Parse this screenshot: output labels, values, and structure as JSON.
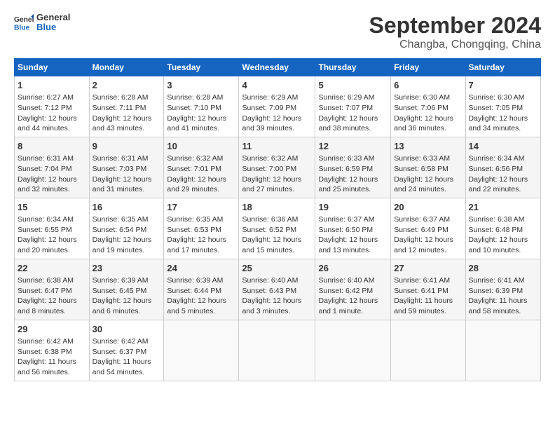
{
  "header": {
    "logo_general": "General",
    "logo_blue": "Blue",
    "month_title": "September 2024",
    "location": "Changba, Chongqing, China"
  },
  "days_of_week": [
    "Sunday",
    "Monday",
    "Tuesday",
    "Wednesday",
    "Thursday",
    "Friday",
    "Saturday"
  ],
  "weeks": [
    [
      {
        "day": "1",
        "lines": [
          "Sunrise: 6:27 AM",
          "Sunset: 7:12 PM",
          "Daylight: 12 hours",
          "and 44 minutes."
        ]
      },
      {
        "day": "2",
        "lines": [
          "Sunrise: 6:28 AM",
          "Sunset: 7:11 PM",
          "Daylight: 12 hours",
          "and 43 minutes."
        ]
      },
      {
        "day": "3",
        "lines": [
          "Sunrise: 6:28 AM",
          "Sunset: 7:10 PM",
          "Daylight: 12 hours",
          "and 41 minutes."
        ]
      },
      {
        "day": "4",
        "lines": [
          "Sunrise: 6:29 AM",
          "Sunset: 7:09 PM",
          "Daylight: 12 hours",
          "and 39 minutes."
        ]
      },
      {
        "day": "5",
        "lines": [
          "Sunrise: 6:29 AM",
          "Sunset: 7:07 PM",
          "Daylight: 12 hours",
          "and 38 minutes."
        ]
      },
      {
        "day": "6",
        "lines": [
          "Sunrise: 6:30 AM",
          "Sunset: 7:06 PM",
          "Daylight: 12 hours",
          "and 36 minutes."
        ]
      },
      {
        "day": "7",
        "lines": [
          "Sunrise: 6:30 AM",
          "Sunset: 7:05 PM",
          "Daylight: 12 hours",
          "and 34 minutes."
        ]
      }
    ],
    [
      {
        "day": "8",
        "lines": [
          "Sunrise: 6:31 AM",
          "Sunset: 7:04 PM",
          "Daylight: 12 hours",
          "and 32 minutes."
        ]
      },
      {
        "day": "9",
        "lines": [
          "Sunrise: 6:31 AM",
          "Sunset: 7:03 PM",
          "Daylight: 12 hours",
          "and 31 minutes."
        ]
      },
      {
        "day": "10",
        "lines": [
          "Sunrise: 6:32 AM",
          "Sunset: 7:01 PM",
          "Daylight: 12 hours",
          "and 29 minutes."
        ]
      },
      {
        "day": "11",
        "lines": [
          "Sunrise: 6:32 AM",
          "Sunset: 7:00 PM",
          "Daylight: 12 hours",
          "and 27 minutes."
        ]
      },
      {
        "day": "12",
        "lines": [
          "Sunrise: 6:33 AM",
          "Sunset: 6:59 PM",
          "Daylight: 12 hours",
          "and 25 minutes."
        ]
      },
      {
        "day": "13",
        "lines": [
          "Sunrise: 6:33 AM",
          "Sunset: 6:58 PM",
          "Daylight: 12 hours",
          "and 24 minutes."
        ]
      },
      {
        "day": "14",
        "lines": [
          "Sunrise: 6:34 AM",
          "Sunset: 6:56 PM",
          "Daylight: 12 hours",
          "and 22 minutes."
        ]
      }
    ],
    [
      {
        "day": "15",
        "lines": [
          "Sunrise: 6:34 AM",
          "Sunset: 6:55 PM",
          "Daylight: 12 hours",
          "and 20 minutes."
        ]
      },
      {
        "day": "16",
        "lines": [
          "Sunrise: 6:35 AM",
          "Sunset: 6:54 PM",
          "Daylight: 12 hours",
          "and 19 minutes."
        ]
      },
      {
        "day": "17",
        "lines": [
          "Sunrise: 6:35 AM",
          "Sunset: 6:53 PM",
          "Daylight: 12 hours",
          "and 17 minutes."
        ]
      },
      {
        "day": "18",
        "lines": [
          "Sunrise: 6:36 AM",
          "Sunset: 6:52 PM",
          "Daylight: 12 hours",
          "and 15 minutes."
        ]
      },
      {
        "day": "19",
        "lines": [
          "Sunrise: 6:37 AM",
          "Sunset: 6:50 PM",
          "Daylight: 12 hours",
          "and 13 minutes."
        ]
      },
      {
        "day": "20",
        "lines": [
          "Sunrise: 6:37 AM",
          "Sunset: 6:49 PM",
          "Daylight: 12 hours",
          "and 12 minutes."
        ]
      },
      {
        "day": "21",
        "lines": [
          "Sunrise: 6:38 AM",
          "Sunset: 6:48 PM",
          "Daylight: 12 hours",
          "and 10 minutes."
        ]
      }
    ],
    [
      {
        "day": "22",
        "lines": [
          "Sunrise: 6:38 AM",
          "Sunset: 6:47 PM",
          "Daylight: 12 hours",
          "and 8 minutes."
        ]
      },
      {
        "day": "23",
        "lines": [
          "Sunrise: 6:39 AM",
          "Sunset: 6:45 PM",
          "Daylight: 12 hours",
          "and 6 minutes."
        ]
      },
      {
        "day": "24",
        "lines": [
          "Sunrise: 6:39 AM",
          "Sunset: 6:44 PM",
          "Daylight: 12 hours",
          "and 5 minutes."
        ]
      },
      {
        "day": "25",
        "lines": [
          "Sunrise: 6:40 AM",
          "Sunset: 6:43 PM",
          "Daylight: 12 hours",
          "and 3 minutes."
        ]
      },
      {
        "day": "26",
        "lines": [
          "Sunrise: 6:40 AM",
          "Sunset: 6:42 PM",
          "Daylight: 12 hours",
          "and 1 minute."
        ]
      },
      {
        "day": "27",
        "lines": [
          "Sunrise: 6:41 AM",
          "Sunset: 6:41 PM",
          "Daylight: 11 hours",
          "and 59 minutes."
        ]
      },
      {
        "day": "28",
        "lines": [
          "Sunrise: 6:41 AM",
          "Sunset: 6:39 PM",
          "Daylight: 11 hours",
          "and 58 minutes."
        ]
      }
    ],
    [
      {
        "day": "29",
        "lines": [
          "Sunrise: 6:42 AM",
          "Sunset: 6:38 PM",
          "Daylight: 11 hours",
          "and 56 minutes."
        ]
      },
      {
        "day": "30",
        "lines": [
          "Sunrise: 6:42 AM",
          "Sunset: 6:37 PM",
          "Daylight: 11 hours",
          "and 54 minutes."
        ]
      },
      {
        "day": "",
        "lines": []
      },
      {
        "day": "",
        "lines": []
      },
      {
        "day": "",
        "lines": []
      },
      {
        "day": "",
        "lines": []
      },
      {
        "day": "",
        "lines": []
      }
    ]
  ]
}
